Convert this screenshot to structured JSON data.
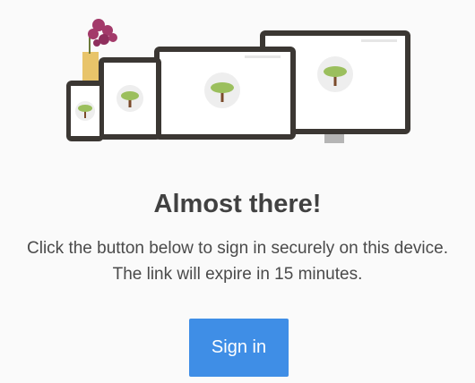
{
  "illustration": {
    "icon": "devices-illustration-icon",
    "device_frame_color": "#3b3733",
    "screen_color": "#ffffff",
    "tree_canopy_color": "#9bbf5d",
    "tree_trunk_color": "#7a4a2a",
    "flower_color": "#a33a6a",
    "vase_color": "#e8c46a"
  },
  "main": {
    "headline": "Almost there!",
    "message_line1": "Click the button below to sign in securely on this device.",
    "message_line2": "The link will expire in 15 minutes."
  },
  "actions": {
    "signin_label": "Sign in",
    "accent": "#3f8ee6"
  }
}
